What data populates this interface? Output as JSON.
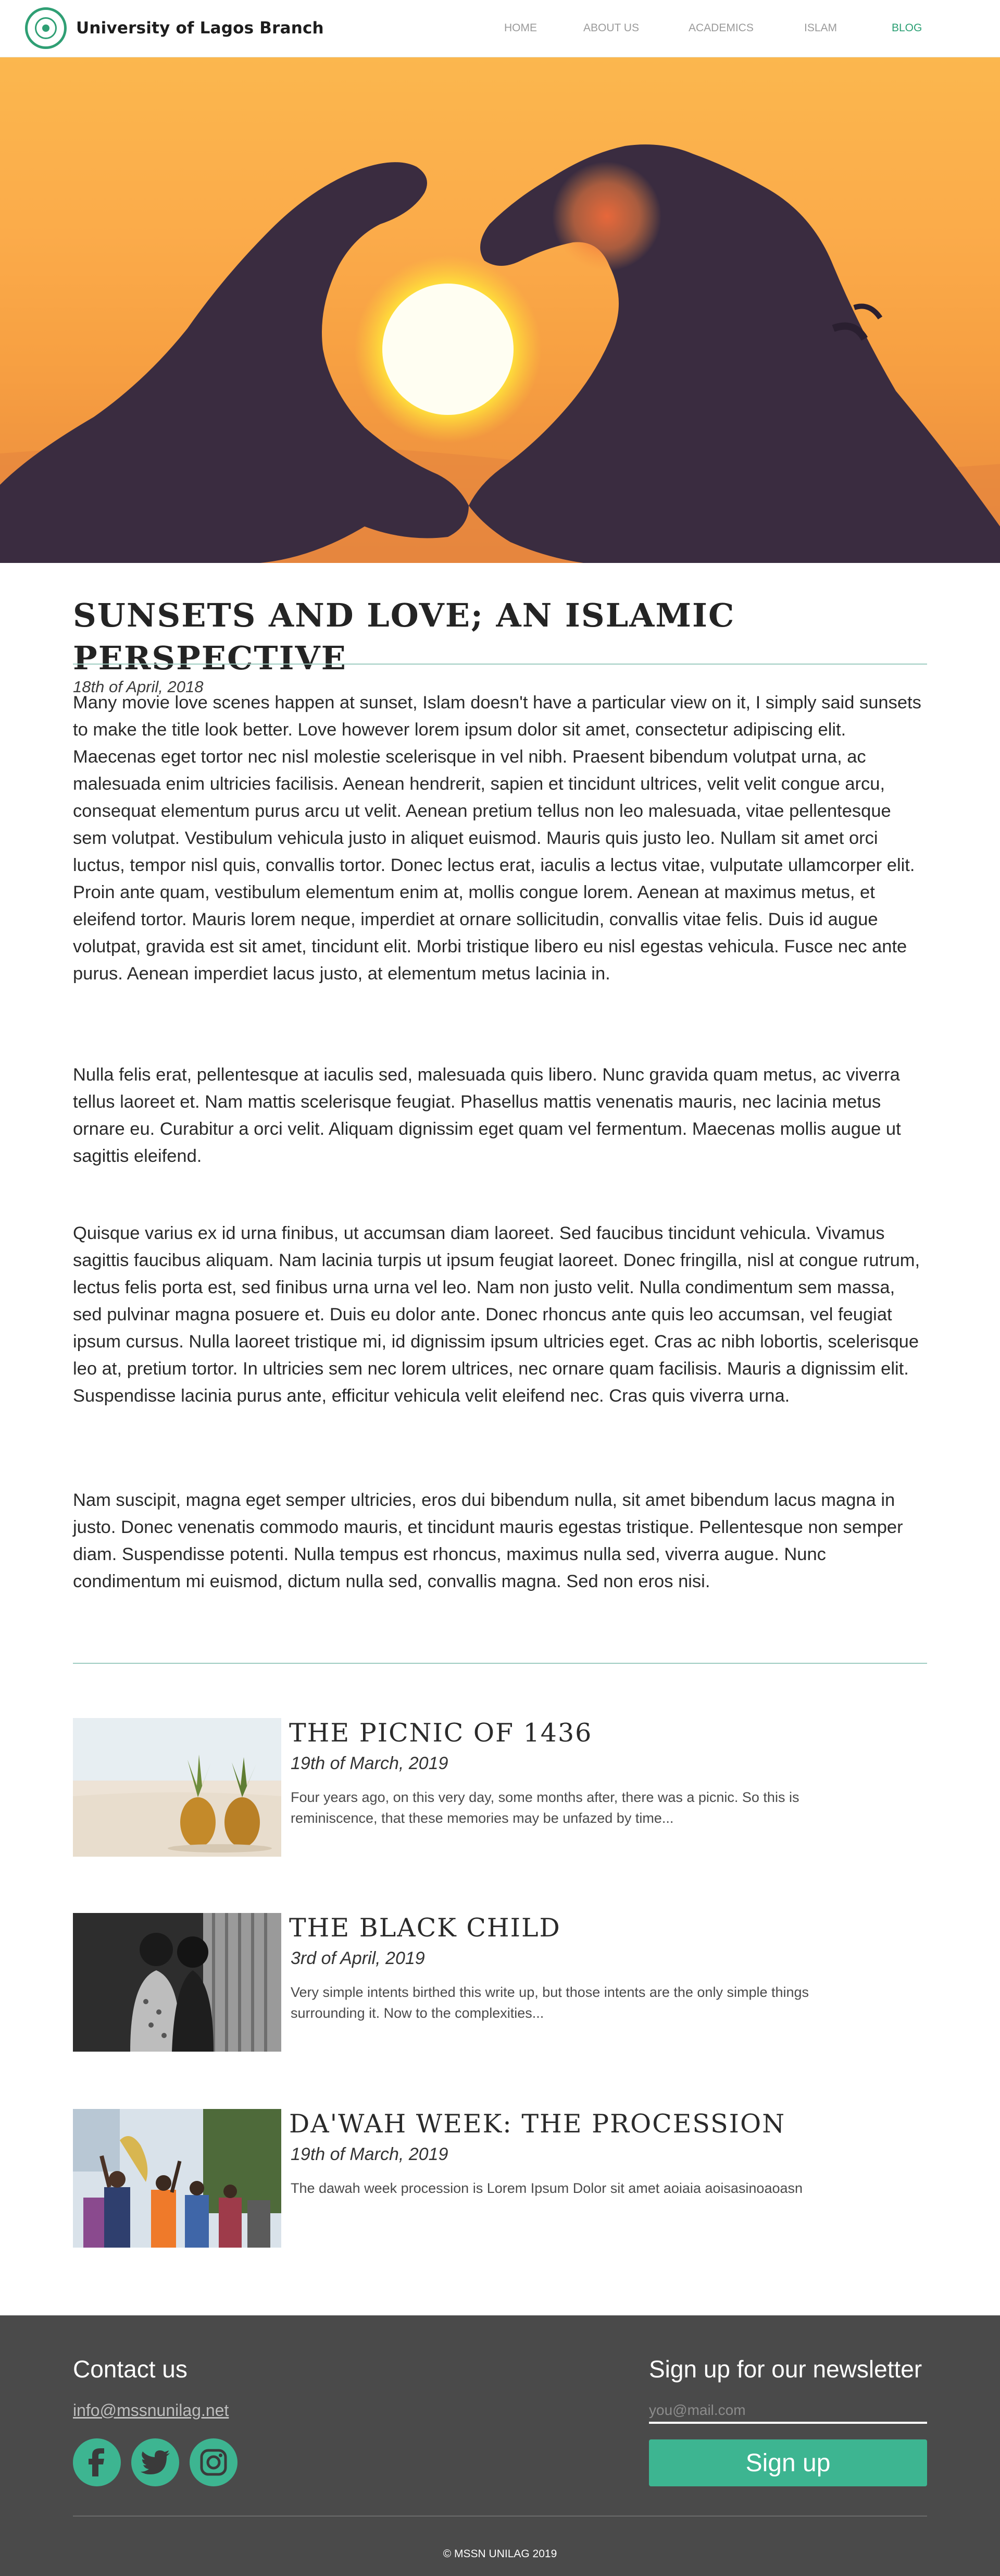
{
  "header": {
    "brand_name": "University of Lagos Branch",
    "nav": [
      {
        "label": "HOME"
      },
      {
        "label": "ABOUT US"
      },
      {
        "label": "ACADEMICS"
      },
      {
        "label": "ISLAM"
      },
      {
        "label": "BLOG",
        "active": true
      }
    ]
  },
  "colors": {
    "accent": "#2a9f73",
    "button": "#3db591",
    "footer_bg": "#4a4a4a",
    "rule": "#9dccc1"
  },
  "article": {
    "title": "SUNSETS AND LOVE; AN ISLAMIC PERSPECTIVE",
    "date": "18th of April, 2018",
    "paragraphs": [
      "Many movie love scenes happen at sunset, Islam doesn't have a particular view on it, I simply said sunsets to make the title look better. Love however lorem ipsum dolor sit amet, consectetur adipiscing elit. Maecenas eget tortor nec nisl molestie scelerisque in vel nibh. Praesent bibendum volutpat urna, ac malesuada enim ultricies facilisis. Aenean hendrerit, sapien et tincidunt ultrices, velit velit congue arcu, consequat elementum purus arcu ut velit. Aenean pretium tellus non leo malesuada, vitae pellentesque sem volutpat. Vestibulum vehicula justo in aliquet euismod. Mauris quis justo leo. Nullam sit amet orci luctus, tempor nisl quis, convallis tortor. Donec lectus erat, iaculis a lectus vitae, vulputate ullamcorper elit. Proin ante quam, vestibulum elementum enim at, mollis congue lorem. Aenean at maximus metus, et eleifend tortor. Mauris lorem neque, imperdiet at ornare sollicitudin, convallis vitae felis. Duis id augue volutpat, gravida est sit amet, tincidunt elit. Morbi tristique libero eu nisl egestas vehicula. Fusce nec ante purus. Aenean imperdiet lacus justo, at elementum metus lacinia in.",
      "Nulla felis erat, pellentesque at iaculis sed, malesuada quis libero. Nunc gravida quam metus, ac viverra tellus laoreet et. Nam mattis scelerisque feugiat. Phasellus mattis venenatis mauris, nec lacinia metus ornare eu. Curabitur a orci velit. Aliquam dignissim eget quam vel fermentum. Maecenas mollis augue ut sagittis eleifend.",
      "Quisque varius ex id urna finibus, ut accumsan diam laoreet. Sed faucibus tincidunt vehicula. Vivamus sagittis faucibus aliquam. Nam lacinia turpis ut ipsum feugiat laoreet. Donec fringilla, nisl at congue rutrum, lectus felis porta est, sed finibus urna urna vel leo. Nam non justo velit. Nulla condimentum sem massa, sed pulvinar magna posuere et. Duis eu dolor ante. Donec rhoncus ante quis leo accumsan, vel feugiat ipsum cursus. Nulla laoreet tristique mi, id dignissim ipsum ultricies eget. Cras ac nibh lobortis, scelerisque leo at, pretium tortor. In ultricies sem nec lorem ultrices, nec ornare quam facilisis. Mauris a dignissim elit. Suspendisse lacinia purus ante, efficitur vehicula velit eleifend nec. Cras quis viverra urna.",
      "Nam suscipit, magna eget semper ultricies, eros dui bibendum nulla, sit amet bibendum lacus magna in justo. Donec venenatis commodo mauris, et tincidunt mauris egestas tristique. Pellentesque non semper diam. Suspendisse potenti. Nulla tempus est rhoncus, maximus nulla sed, viverra augue. Nunc condimentum mi euismod, dictum nulla sed, convallis magna. Sed non eros nisi."
    ]
  },
  "related_posts": [
    {
      "title": "THE PICNIC OF 1436",
      "date": "19th of March, 2019",
      "excerpt": "Four years ago, on this very day, some months after, there was a picnic. So this is reminiscence, that these memories may be unfazed by time..."
    },
    {
      "title": "THE BLACK CHILD",
      "date": "3rd of April, 2019",
      "excerpt": "Very simple intents birthed this write up, but those intents are the only simple things surrounding it. Now to the complexities..."
    },
    {
      "title": "DA'WAH WEEK: THE PROCESSION",
      "date": "19th of March, 2019",
      "excerpt": "The dawah week procession is Lorem Ipsum Dolor sit amet aoiaia aoisasinoaoasn"
    }
  ],
  "footer": {
    "contact_heading": "Contact us",
    "email": "info@mssnunilag.net",
    "social_icons": [
      "facebook-icon",
      "twitter-icon",
      "instagram-icon"
    ],
    "newsletter_heading": "Sign up for our newsletter",
    "newsletter_placeholder": "you@mail.com",
    "signup_label": "Sign up",
    "copyright": "© MSSN UNILAG 2019"
  }
}
